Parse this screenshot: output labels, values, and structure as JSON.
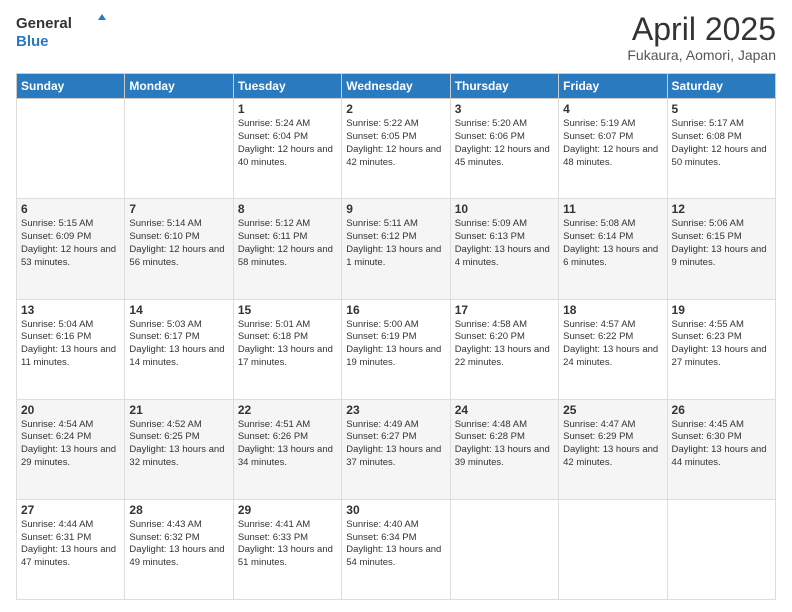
{
  "logo": {
    "general": "General",
    "blue": "Blue"
  },
  "header": {
    "title": "April 2025",
    "subtitle": "Fukaura, Aomori, Japan"
  },
  "weekdays": [
    "Sunday",
    "Monday",
    "Tuesday",
    "Wednesday",
    "Thursday",
    "Friday",
    "Saturday"
  ],
  "weeks": [
    [
      {
        "day": "",
        "sunrise": "",
        "sunset": "",
        "daylight": ""
      },
      {
        "day": "",
        "sunrise": "",
        "sunset": "",
        "daylight": ""
      },
      {
        "day": "1",
        "sunrise": "Sunrise: 5:24 AM",
        "sunset": "Sunset: 6:04 PM",
        "daylight": "Daylight: 12 hours and 40 minutes."
      },
      {
        "day": "2",
        "sunrise": "Sunrise: 5:22 AM",
        "sunset": "Sunset: 6:05 PM",
        "daylight": "Daylight: 12 hours and 42 minutes."
      },
      {
        "day": "3",
        "sunrise": "Sunrise: 5:20 AM",
        "sunset": "Sunset: 6:06 PM",
        "daylight": "Daylight: 12 hours and 45 minutes."
      },
      {
        "day": "4",
        "sunrise": "Sunrise: 5:19 AM",
        "sunset": "Sunset: 6:07 PM",
        "daylight": "Daylight: 12 hours and 48 minutes."
      },
      {
        "day": "5",
        "sunrise": "Sunrise: 5:17 AM",
        "sunset": "Sunset: 6:08 PM",
        "daylight": "Daylight: 12 hours and 50 minutes."
      }
    ],
    [
      {
        "day": "6",
        "sunrise": "Sunrise: 5:15 AM",
        "sunset": "Sunset: 6:09 PM",
        "daylight": "Daylight: 12 hours and 53 minutes."
      },
      {
        "day": "7",
        "sunrise": "Sunrise: 5:14 AM",
        "sunset": "Sunset: 6:10 PM",
        "daylight": "Daylight: 12 hours and 56 minutes."
      },
      {
        "day": "8",
        "sunrise": "Sunrise: 5:12 AM",
        "sunset": "Sunset: 6:11 PM",
        "daylight": "Daylight: 12 hours and 58 minutes."
      },
      {
        "day": "9",
        "sunrise": "Sunrise: 5:11 AM",
        "sunset": "Sunset: 6:12 PM",
        "daylight": "Daylight: 13 hours and 1 minute."
      },
      {
        "day": "10",
        "sunrise": "Sunrise: 5:09 AM",
        "sunset": "Sunset: 6:13 PM",
        "daylight": "Daylight: 13 hours and 4 minutes."
      },
      {
        "day": "11",
        "sunrise": "Sunrise: 5:08 AM",
        "sunset": "Sunset: 6:14 PM",
        "daylight": "Daylight: 13 hours and 6 minutes."
      },
      {
        "day": "12",
        "sunrise": "Sunrise: 5:06 AM",
        "sunset": "Sunset: 6:15 PM",
        "daylight": "Daylight: 13 hours and 9 minutes."
      }
    ],
    [
      {
        "day": "13",
        "sunrise": "Sunrise: 5:04 AM",
        "sunset": "Sunset: 6:16 PM",
        "daylight": "Daylight: 13 hours and 11 minutes."
      },
      {
        "day": "14",
        "sunrise": "Sunrise: 5:03 AM",
        "sunset": "Sunset: 6:17 PM",
        "daylight": "Daylight: 13 hours and 14 minutes."
      },
      {
        "day": "15",
        "sunrise": "Sunrise: 5:01 AM",
        "sunset": "Sunset: 6:18 PM",
        "daylight": "Daylight: 13 hours and 17 minutes."
      },
      {
        "day": "16",
        "sunrise": "Sunrise: 5:00 AM",
        "sunset": "Sunset: 6:19 PM",
        "daylight": "Daylight: 13 hours and 19 minutes."
      },
      {
        "day": "17",
        "sunrise": "Sunrise: 4:58 AM",
        "sunset": "Sunset: 6:20 PM",
        "daylight": "Daylight: 13 hours and 22 minutes."
      },
      {
        "day": "18",
        "sunrise": "Sunrise: 4:57 AM",
        "sunset": "Sunset: 6:22 PM",
        "daylight": "Daylight: 13 hours and 24 minutes."
      },
      {
        "day": "19",
        "sunrise": "Sunrise: 4:55 AM",
        "sunset": "Sunset: 6:23 PM",
        "daylight": "Daylight: 13 hours and 27 minutes."
      }
    ],
    [
      {
        "day": "20",
        "sunrise": "Sunrise: 4:54 AM",
        "sunset": "Sunset: 6:24 PM",
        "daylight": "Daylight: 13 hours and 29 minutes."
      },
      {
        "day": "21",
        "sunrise": "Sunrise: 4:52 AM",
        "sunset": "Sunset: 6:25 PM",
        "daylight": "Daylight: 13 hours and 32 minutes."
      },
      {
        "day": "22",
        "sunrise": "Sunrise: 4:51 AM",
        "sunset": "Sunset: 6:26 PM",
        "daylight": "Daylight: 13 hours and 34 minutes."
      },
      {
        "day": "23",
        "sunrise": "Sunrise: 4:49 AM",
        "sunset": "Sunset: 6:27 PM",
        "daylight": "Daylight: 13 hours and 37 minutes."
      },
      {
        "day": "24",
        "sunrise": "Sunrise: 4:48 AM",
        "sunset": "Sunset: 6:28 PM",
        "daylight": "Daylight: 13 hours and 39 minutes."
      },
      {
        "day": "25",
        "sunrise": "Sunrise: 4:47 AM",
        "sunset": "Sunset: 6:29 PM",
        "daylight": "Daylight: 13 hours and 42 minutes."
      },
      {
        "day": "26",
        "sunrise": "Sunrise: 4:45 AM",
        "sunset": "Sunset: 6:30 PM",
        "daylight": "Daylight: 13 hours and 44 minutes."
      }
    ],
    [
      {
        "day": "27",
        "sunrise": "Sunrise: 4:44 AM",
        "sunset": "Sunset: 6:31 PM",
        "daylight": "Daylight: 13 hours and 47 minutes."
      },
      {
        "day": "28",
        "sunrise": "Sunrise: 4:43 AM",
        "sunset": "Sunset: 6:32 PM",
        "daylight": "Daylight: 13 hours and 49 minutes."
      },
      {
        "day": "29",
        "sunrise": "Sunrise: 4:41 AM",
        "sunset": "Sunset: 6:33 PM",
        "daylight": "Daylight: 13 hours and 51 minutes."
      },
      {
        "day": "30",
        "sunrise": "Sunrise: 4:40 AM",
        "sunset": "Sunset: 6:34 PM",
        "daylight": "Daylight: 13 hours and 54 minutes."
      },
      {
        "day": "",
        "sunrise": "",
        "sunset": "",
        "daylight": ""
      },
      {
        "day": "",
        "sunrise": "",
        "sunset": "",
        "daylight": ""
      },
      {
        "day": "",
        "sunrise": "",
        "sunset": "",
        "daylight": ""
      }
    ]
  ]
}
